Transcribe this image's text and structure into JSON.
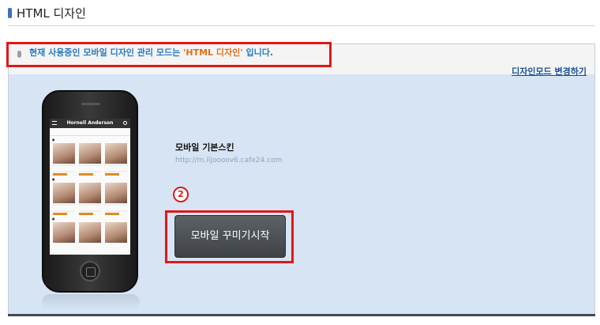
{
  "page": {
    "title": "HTML 디자인"
  },
  "notice": {
    "prefix": "현재 사용중인 모바일 디자인 관리 모드는 ",
    "mode": "'HTML 디자인'",
    "suffix": " 입니다."
  },
  "mode_link": "디자인모드 변경하기",
  "skin": {
    "name": "모바일 기본스킨",
    "url": "http://m.iljoooov6.cafe24.com"
  },
  "phone_preview": {
    "header_title": "Hornell Anderson"
  },
  "step_badge": "2",
  "start_button": "모바일 꾸미기시작",
  "colors": {
    "panel_bg": "#d6e4f3",
    "highlight": "#e01818",
    "notice_text": "#2b7ac0",
    "notice_mode": "#e0701a",
    "button_bg": "#4a4e52"
  }
}
